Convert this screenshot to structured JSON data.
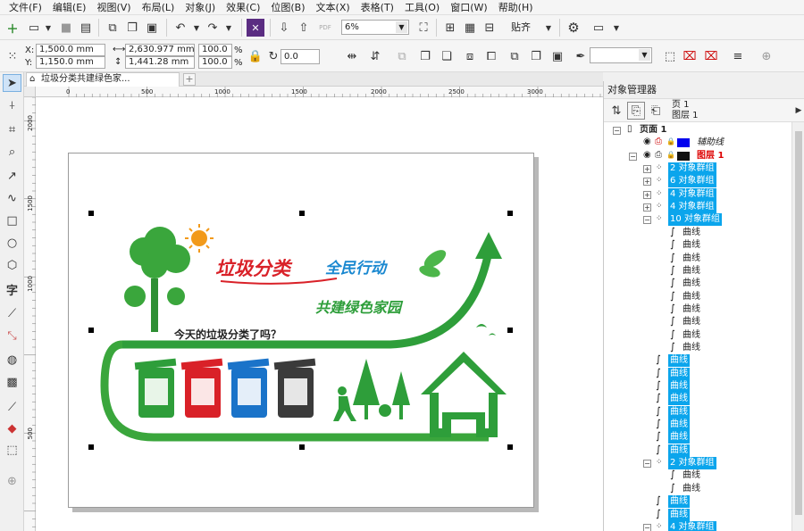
{
  "menu": [
    "文件(F)",
    "编辑(E)",
    "视图(V)",
    "布局(L)",
    "对象(J)",
    "效果(C)",
    "位图(B)",
    "文本(X)",
    "表格(T)",
    "工具(O)",
    "窗口(W)",
    "帮助(H)"
  ],
  "toolbar": {
    "zoom_value": "6%",
    "snap_label": "贴齐"
  },
  "props": {
    "x": "1,500.0 mm",
    "y": "1,150.0 mm",
    "width": "2,630.977 mm",
    "height": "1,441.28 mm",
    "scale_x": "100.0",
    "scale_y": "100.0",
    "percent": "%",
    "rotation": "0.0",
    "x_label": "X:",
    "y_label": "Y:"
  },
  "document": {
    "tab_title": "垃圾分类共建绿色家..."
  },
  "rulers": {
    "h_ticks": [
      "0",
      "500",
      "1000",
      "1500",
      "2000",
      "2500",
      "3000"
    ],
    "v_ticks": [
      "2000",
      "1500",
      "1000",
      "500"
    ]
  },
  "artwork": {
    "headline_left": "垃圾分类",
    "headline_right": "全民行动",
    "subheadline": "共建绿色家园",
    "question": "今天的垃圾分类了吗？",
    "colors": {
      "green": "#2e9e3a",
      "red": "#d92128",
      "blue": "#1a73c9",
      "dark": "#3b3b3b",
      "sun": "#f29a1a"
    }
  },
  "object_manager": {
    "title": "对象管理器",
    "page_label": "页 1",
    "layer_label": "图层 1",
    "tree": [
      {
        "indent": 0,
        "text": "页面 1",
        "type": "page"
      },
      {
        "indent": 1,
        "text": "辅助线",
        "type": "guides"
      },
      {
        "indent": 1,
        "text": "图层 1",
        "type": "layer"
      },
      {
        "indent": 2,
        "text": "2 对象群组",
        "type": "group-collapsed",
        "selected": true
      },
      {
        "indent": 2,
        "text": "6 对象群组",
        "type": "group-collapsed",
        "selected": true
      },
      {
        "indent": 2,
        "text": "4 对象群组",
        "type": "group-collapsed",
        "selected": true
      },
      {
        "indent": 2,
        "text": "4 对象群组",
        "type": "group-collapsed",
        "selected": true
      },
      {
        "indent": 2,
        "text": "10 对象群组",
        "type": "group-expanded",
        "selected": true
      },
      {
        "indent": 3,
        "text": "曲线",
        "type": "curve",
        "selected": false
      },
      {
        "indent": 3,
        "text": "曲线",
        "type": "curve",
        "selected": false
      },
      {
        "indent": 3,
        "text": "曲线",
        "type": "curve",
        "selected": false
      },
      {
        "indent": 3,
        "text": "曲线",
        "type": "curve",
        "selected": false
      },
      {
        "indent": 3,
        "text": "曲线",
        "type": "curve",
        "selected": false
      },
      {
        "indent": 3,
        "text": "曲线",
        "type": "curve",
        "selected": false
      },
      {
        "indent": 3,
        "text": "曲线",
        "type": "curve",
        "selected": false
      },
      {
        "indent": 3,
        "text": "曲线",
        "type": "curve",
        "selected": false
      },
      {
        "indent": 3,
        "text": "曲线",
        "type": "curve",
        "selected": false
      },
      {
        "indent": 3,
        "text": "曲线",
        "type": "curve",
        "selected": false
      },
      {
        "indent": 2,
        "text": "曲线",
        "type": "curve",
        "selected": true
      },
      {
        "indent": 2,
        "text": "曲线",
        "type": "curve",
        "selected": true
      },
      {
        "indent": 2,
        "text": "曲线",
        "type": "curve",
        "selected": true
      },
      {
        "indent": 2,
        "text": "曲线",
        "type": "curve",
        "selected": true
      },
      {
        "indent": 2,
        "text": "曲线",
        "type": "curve",
        "selected": true
      },
      {
        "indent": 2,
        "text": "曲线",
        "type": "curve",
        "selected": true
      },
      {
        "indent": 2,
        "text": "曲线",
        "type": "curve",
        "selected": true
      },
      {
        "indent": 2,
        "text": "曲线",
        "type": "curve",
        "selected": true
      },
      {
        "indent": 2,
        "text": "2 对象群组",
        "type": "group-expanded",
        "selected": true
      },
      {
        "indent": 3,
        "text": "曲线",
        "type": "curve",
        "selected": false
      },
      {
        "indent": 3,
        "text": "曲线",
        "type": "curve",
        "selected": false
      },
      {
        "indent": 2,
        "text": "曲线",
        "type": "curve",
        "selected": true
      },
      {
        "indent": 2,
        "text": "曲线",
        "type": "curve",
        "selected": true
      },
      {
        "indent": 2,
        "text": "4 对象群组",
        "type": "group-expanded",
        "selected": true
      }
    ]
  }
}
